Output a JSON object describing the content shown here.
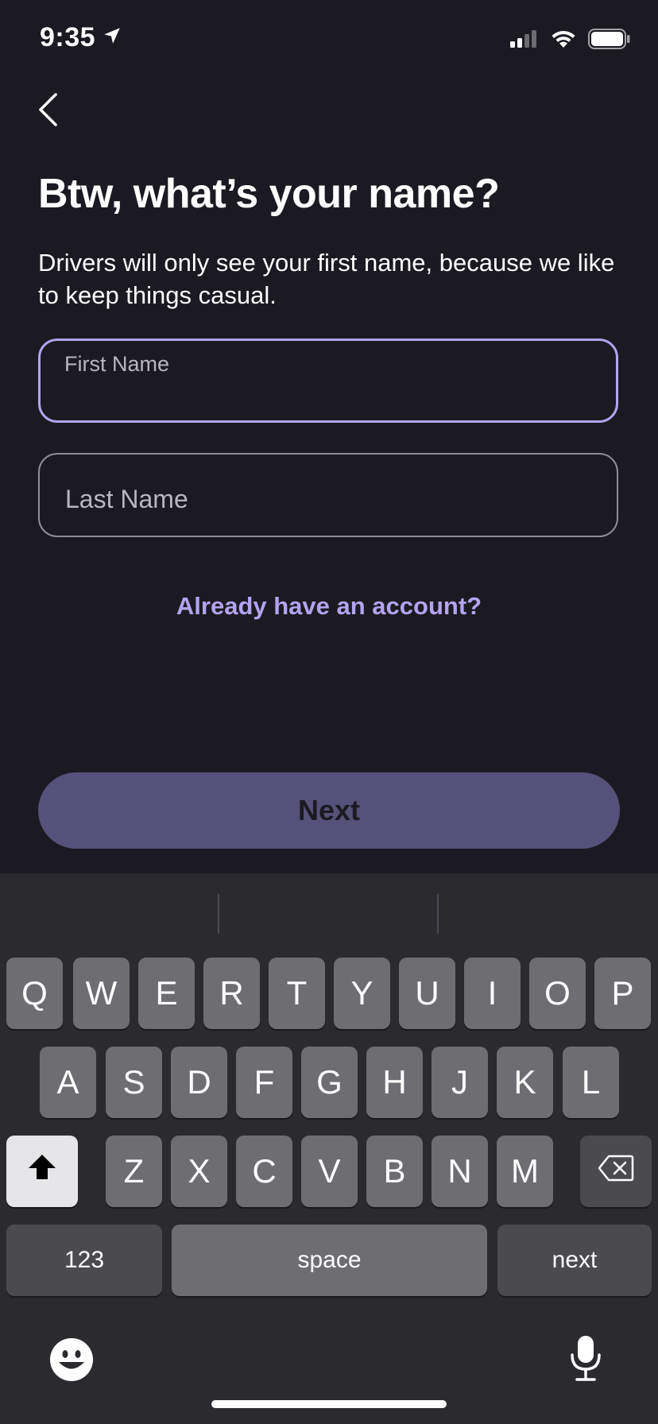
{
  "status_bar": {
    "time": "9:35"
  },
  "header": {
    "back_icon": "chevron-left-icon"
  },
  "content": {
    "title": "Btw, what’s your name?",
    "subtitle": "Drivers will only see your first name, because we like to keep things casual.",
    "first_name": {
      "label": "First Name",
      "value": ""
    },
    "last_name": {
      "placeholder": "Last Name",
      "value": ""
    },
    "login_link": "Already have an account?",
    "next_button": "Next"
  },
  "colors": {
    "background": "#1b1a22",
    "accent": "#b3a3f0",
    "button": "#56517a"
  },
  "keyboard": {
    "row1": [
      "Q",
      "W",
      "E",
      "R",
      "T",
      "Y",
      "U",
      "I",
      "O",
      "P"
    ],
    "row2": [
      "A",
      "S",
      "D",
      "F",
      "G",
      "H",
      "J",
      "K",
      "L"
    ],
    "row3": [
      "Z",
      "X",
      "C",
      "V",
      "B",
      "N",
      "M"
    ],
    "numbers_key": "123",
    "space_key": "space",
    "return_key": "next",
    "shift_icon": "shift-icon",
    "delete_icon": "delete-icon",
    "emoji_icon": "emoji-icon",
    "mic_icon": "microphone-icon"
  }
}
